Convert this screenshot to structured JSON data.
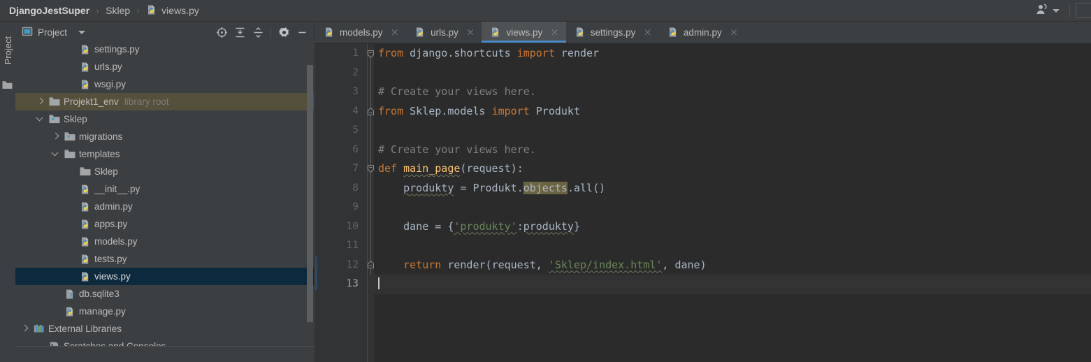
{
  "titlebar": {
    "breadcrumbs": [
      {
        "label": "DjangoJestSuper",
        "bold": true,
        "icon": null
      },
      {
        "label": "Sklep",
        "bold": false,
        "icon": null
      },
      {
        "label": "views.py",
        "bold": false,
        "icon": "python-file-icon"
      }
    ],
    "separator": "›",
    "user_icon": "user-account-icon",
    "user_caret": "caret-down-icon"
  },
  "toolstrip": {
    "vertical_tab_label": "Project",
    "folder_icon": "folder-icon"
  },
  "project_panel": {
    "title": "Project",
    "title_icon": "project-view-icon",
    "dropdown_icon": "caret-down-icon",
    "header_buttons": [
      {
        "name": "select-opened-file-icon",
        "glyph": "target"
      },
      {
        "name": "expand-all-icon",
        "glyph": "expand"
      },
      {
        "name": "collapse-all-icon",
        "glyph": "collapse"
      },
      {
        "name": "settings-gear-icon",
        "glyph": "gear"
      },
      {
        "name": "hide-panel-icon",
        "glyph": "minus"
      }
    ],
    "tree": [
      {
        "label": "settings.py",
        "indent": 4,
        "icon": "python-file-icon",
        "arrow": "none",
        "state": "normal",
        "clipped": true
      },
      {
        "label": "urls.py",
        "indent": 4,
        "icon": "python-file-icon",
        "arrow": "none",
        "state": "normal"
      },
      {
        "label": "wsgi.py",
        "indent": 4,
        "icon": "python-file-icon",
        "arrow": "none",
        "state": "normal"
      },
      {
        "label": "Projekt1_env",
        "sublabel": "library root",
        "indent": 2,
        "icon": "folder-icon",
        "arrow": "right",
        "state": "olive"
      },
      {
        "label": "Sklep",
        "indent": 2,
        "icon": "module-folder-icon",
        "arrow": "down",
        "state": "normal"
      },
      {
        "label": "migrations",
        "indent": 3,
        "icon": "module-folder-icon",
        "arrow": "right",
        "state": "normal"
      },
      {
        "label": "templates",
        "indent": 3,
        "icon": "folder-icon",
        "arrow": "down",
        "state": "normal"
      },
      {
        "label": "Sklep",
        "indent": 4,
        "icon": "folder-icon",
        "arrow": "none",
        "state": "normal"
      },
      {
        "label": "__init__.py",
        "indent": 4,
        "icon": "python-file-icon",
        "arrow": "none",
        "state": "normal"
      },
      {
        "label": "admin.py",
        "indent": 4,
        "icon": "python-file-icon",
        "arrow": "none",
        "state": "normal"
      },
      {
        "label": "apps.py",
        "indent": 4,
        "icon": "python-file-icon",
        "arrow": "none",
        "state": "normal"
      },
      {
        "label": "models.py",
        "indent": 4,
        "icon": "python-file-icon",
        "arrow": "none",
        "state": "normal"
      },
      {
        "label": "tests.py",
        "indent": 4,
        "icon": "python-file-icon",
        "arrow": "none",
        "state": "normal"
      },
      {
        "label": "views.py",
        "indent": 4,
        "icon": "python-file-icon",
        "arrow": "none",
        "state": "selected"
      },
      {
        "label": "db.sqlite3",
        "indent": 3,
        "icon": "unknown-file-icon",
        "arrow": "none",
        "state": "normal"
      },
      {
        "label": "manage.py",
        "indent": 3,
        "icon": "python-file-icon",
        "arrow": "none",
        "state": "normal"
      },
      {
        "label": "External Libraries",
        "indent": 1,
        "icon": "libraries-icon",
        "arrow": "right",
        "state": "normal"
      },
      {
        "label": "Scratches and Consoles",
        "indent": 2,
        "icon": "scratches-icon",
        "arrow": "none",
        "state": "normal"
      }
    ]
  },
  "editor": {
    "tabs": [
      {
        "label": "models.py",
        "icon": "python-file-icon",
        "active": false,
        "close": "×"
      },
      {
        "label": "urls.py",
        "icon": "python-file-icon",
        "active": false,
        "close": "×"
      },
      {
        "label": "views.py",
        "icon": "python-file-icon",
        "active": true,
        "close": "×"
      },
      {
        "label": "settings.py",
        "icon": "python-file-icon",
        "active": false,
        "close": "×"
      },
      {
        "label": "admin.py",
        "icon": "python-file-icon",
        "active": false,
        "close": "×"
      }
    ],
    "active_tab_accent": "#4a88c7",
    "current_line": 13,
    "lines": [
      {
        "num": "1",
        "text": "from django.shortcuts import render"
      },
      {
        "num": "2",
        "text": ""
      },
      {
        "num": "3",
        "text": "# Create your views here."
      },
      {
        "num": "4",
        "text": "from Sklep.models import Produkt"
      },
      {
        "num": "5",
        "text": ""
      },
      {
        "num": "6",
        "text": "# Create your views here."
      },
      {
        "num": "7",
        "text": "def main_page(request):"
      },
      {
        "num": "8",
        "text": "    produkty = Produkt.objects.all()"
      },
      {
        "num": "9",
        "text": ""
      },
      {
        "num": "10",
        "text": "    dane = {'produkty':produkty}"
      },
      {
        "num": "11",
        "text": ""
      },
      {
        "num": "12",
        "text": "    return render(request, 'Sklep/index.html', dane)"
      },
      {
        "num": "13",
        "text": ""
      }
    ],
    "highlighted_token": "objects",
    "colors": {
      "background": "#2b2b2b",
      "gutter": "#313335",
      "keyword": "#cc7832",
      "string": "#6a8759",
      "comment": "#808080",
      "function": "#ffc66d",
      "identifier": "#a9b7c6",
      "token_highlight": "#6b6440",
      "current_line": "#323232"
    }
  }
}
